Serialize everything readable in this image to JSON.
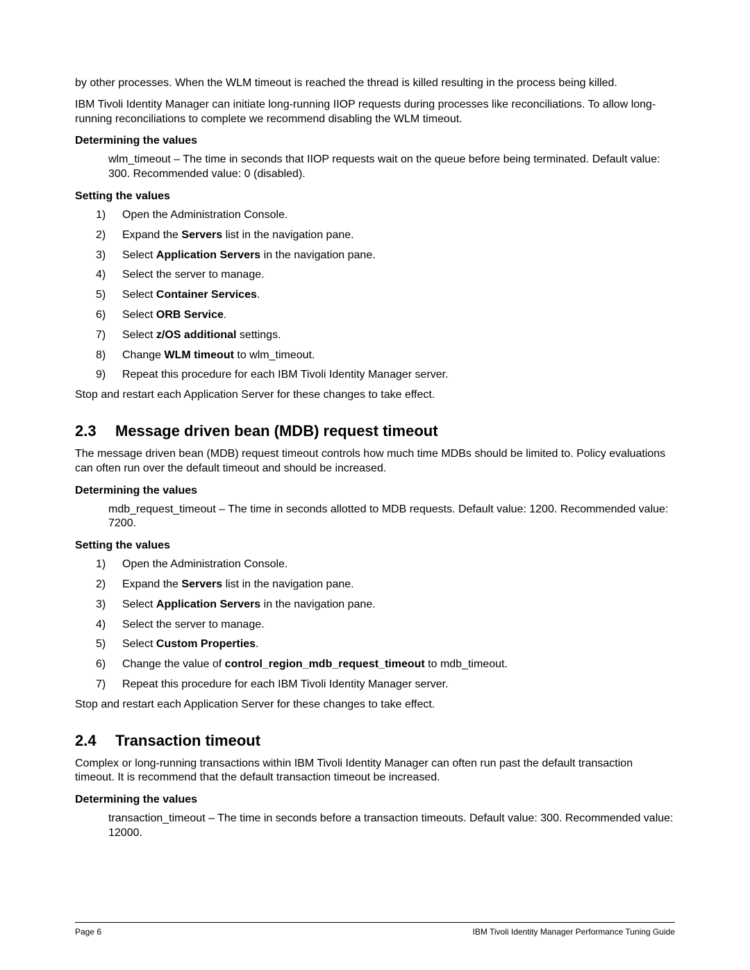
{
  "intro": {
    "p1": "by other processes. When the WLM timeout is reached the thread is killed resulting in the process being killed.",
    "p2": "IBM Tivoli Identity Manager can initiate long-running IIOP requests during processes like reconciliations. To allow long-running reconciliations to complete we recommend disabling the WLM timeout."
  },
  "wlm": {
    "det_head": "Determining the values",
    "det_body": "wlm_timeout – The time in seconds that IIOP requests wait on the queue before being terminated. Default value: 300. Recommended value: 0 (disabled).",
    "set_head": "Setting the values",
    "steps": [
      {
        "n": "1)",
        "pre": "Open the Administration Console."
      },
      {
        "n": "2)",
        "pre": "Expand the ",
        "b": "Servers",
        "post": " list in the navigation pane."
      },
      {
        "n": "3)",
        "pre": "Select ",
        "b": "Application Servers",
        "post": " in the navigation pane."
      },
      {
        "n": "4)",
        "pre": "Select the server to manage."
      },
      {
        "n": "5)",
        "pre": "Select ",
        "b": "Container Services",
        "post": "."
      },
      {
        "n": "6)",
        "pre": "Select ",
        "b": "ORB Service",
        "post": "."
      },
      {
        "n": "7)",
        "pre": "Select ",
        "b": "z/OS additional",
        "post": " settings."
      },
      {
        "n": "8)",
        "pre": "Change ",
        "b": "WLM timeout",
        "post": " to wlm_timeout."
      },
      {
        "n": "9)",
        "pre": "Repeat this procedure for each IBM Tivoli Identity Manager server."
      }
    ],
    "after": "Stop and restart each Application Server for these changes to take effect."
  },
  "s23": {
    "num": "2.3",
    "title": "Message driven bean (MDB) request timeout",
    "p1": "The message driven bean (MDB) request timeout controls how much time MDBs should be limited to. Policy evaluations can often run over the default timeout and should be increased.",
    "det_head": "Determining the values",
    "det_body": "mdb_request_timeout – The time in seconds allotted to MDB requests. Default value: 1200. Recommended value: 7200.",
    "set_head": "Setting the values",
    "steps": [
      {
        "n": "1)",
        "pre": "Open the Administration Console."
      },
      {
        "n": "2)",
        "pre": "Expand the ",
        "b": "Servers",
        "post": " list in the navigation pane."
      },
      {
        "n": "3)",
        "pre": "Select ",
        "b": "Application Servers",
        "post": " in the navigation pane."
      },
      {
        "n": "4)",
        "pre": "Select the server to manage."
      },
      {
        "n": "5)",
        "pre": "Select ",
        "b": "Custom Properties",
        "post": "."
      },
      {
        "n": "6)",
        "pre": "Change the value of ",
        "b": "control_region_mdb_request_timeout",
        "post": " to mdb_timeout."
      },
      {
        "n": "7)",
        "pre": "Repeat this procedure for each IBM Tivoli Identity Manager server."
      }
    ],
    "after": "Stop and restart each Application Server for these changes to take effect."
  },
  "s24": {
    "num": "2.4",
    "title": "Transaction timeout",
    "p1": "Complex or long-running transactions within IBM Tivoli Identity Manager can often run past the default transaction timeout. It is recommend that the default transaction timeout be increased.",
    "det_head": "Determining the values",
    "det_body": "transaction_timeout – The time in seconds before a transaction timeouts. Default value: 300. Recommended value: 12000."
  },
  "footer": {
    "left": "Page 6",
    "right": "IBM Tivoli Identity Manager Performance Tuning Guide"
  }
}
